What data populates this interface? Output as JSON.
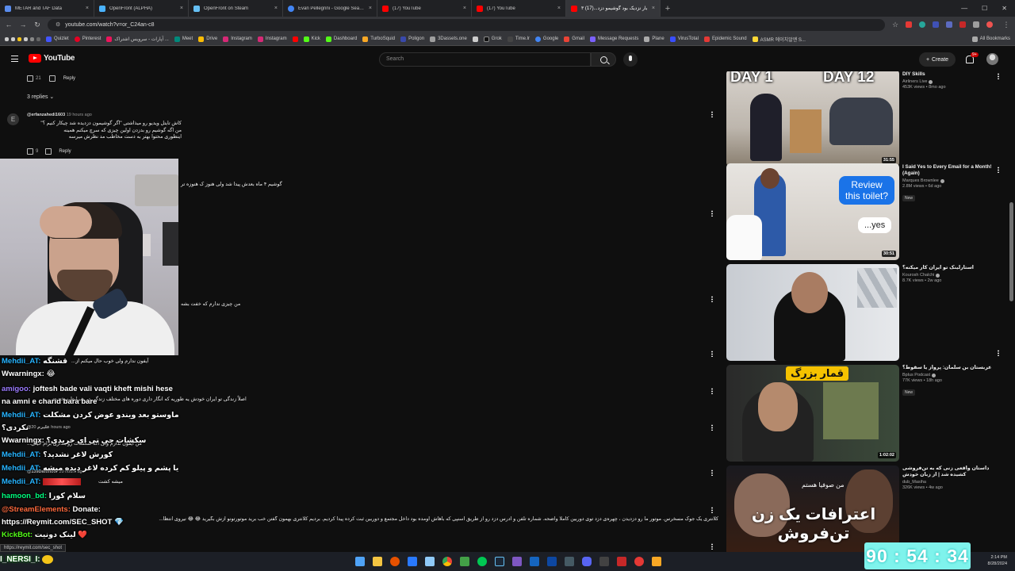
{
  "browser": {
    "tabs": [
      {
        "title": "METAR and TAF Data",
        "color": "#5a8dee"
      },
      {
        "title": "OpenFront (ALPHA)",
        "color": "#4ab3ff"
      },
      {
        "title": "OpenFront on Steam",
        "color": "#1b2838"
      },
      {
        "title": "Evan Pellegrini - Google Search",
        "color": "#4285f4"
      },
      {
        "title": "(17) YouTube",
        "color": "#ff0000"
      },
      {
        "title": "(17) YouTube",
        "color": "#ff0000"
      },
      {
        "title": "۳ بار نزدیک بود گوشیمو دزد...(17)",
        "color": "#ff0000"
      }
    ],
    "url": "youtube.com/watch?v=or_C24an-c8",
    "bookmarks": [
      "Quizlet",
      "Pinterest",
      "آپارات - سرویس اشتراک ...",
      "Meet",
      "Drive",
      "Instagram",
      "Instagram",
      "",
      "Kick",
      "Dashboard",
      "TurboSquid",
      "Poligon",
      "3Dassets.one",
      "",
      "Grok",
      "Time.lr",
      "Google",
      "Gmail",
      "Message Requests",
      "Plane",
      "VirusTotal",
      "Epidemic Sound",
      "ASMR 에이치알엔 S..."
    ],
    "all_bookmarks": "All Bookmarks",
    "status_url": "https://reymit.com/sec_shot"
  },
  "youtube": {
    "logo": "YouTube",
    "search_placeholder": "Search",
    "create": "Create",
    "notifications": "9+"
  },
  "comments": {
    "top_likes": "21",
    "reply": "Reply",
    "replies_toggle": "3 replies",
    "comment1": {
      "avatar": "E",
      "user": "@erfanzahedi1603",
      "time": "19 hours ago",
      "line1": "کاش تایتل ویدیو رو میذاشتی \"اگر گوشیمون دزدیده شد چیکار کنیم ؟\"",
      "line2": "من اگه گوشیم رو بدزدن اولین چیزی که سرچ میکنم همینه",
      "line3": "اینطوری محتوا بهتر به دست مخاطب مد نظرش میرسه",
      "likes": "9"
    },
    "rtl_a": "گوشیم ۴ ماه بعدش پیدا شد ولی هنوز ک هنوزه تر",
    "rtl_b": "من چیزی ندارم که خفت بشه",
    "rtl_c": "آیفون ندارم ولی خوب حال میکنم از...",
    "rtl_d": "اصلاً زندگی تو ایران خودش یه طوریه که انگار داری دوره های مختلف زندگی در شرایط سخت م...",
    "rtl_e": "من ایفون ندارم ولی اگه سکشات رو بندازی برام خیلی...",
    "rtl_f": "میشه کشت",
    "long_comment": "کلانتری یک جوک مسخرس. موتور ما رو دزدیدن ، چهره‌ی دزد توی دوربین کاملا واضحه. شماره تلفن و آدرس دزد رو از طریق اسنپی که باهاش اومده بود داخل مجتمع و دوربین ثبت کرده پیدا کردیم. بردیم کلانتری بهمون گفتن خب برید موتورتونو ازش بگیرید 😂 😂 نیروی انتظا...",
    "user2": "@علیرم",
    "time2": "20 hours ago",
    "user3": "@139Daftmoor",
    "time3": "20 hours ago"
  },
  "chat": [
    {
      "name": "Mehdii_AT:",
      "msg": "قشنگه",
      "color": "#27b4ff"
    },
    {
      "name": "Wwarningx:",
      "msg": "😂",
      "color": "#ffffff"
    },
    {
      "name": "amigoo:",
      "msg": "joftesh bade vali vaqti kheft mishi hese",
      "color": "#ffffff"
    },
    {
      "name": "",
      "msg": "na amni e charid bara bare",
      "color": "#ffffff"
    },
    {
      "name": "Mehdii_AT:",
      "msg": "ماوستو بعد ویندو عوض کردن مشکلت",
      "color": "#27b4ff"
    },
    {
      "name": "",
      "msg": "نکردی؟",
      "color": "#ffffff"
    },
    {
      "name": "Wwarningx:",
      "msg": "سکشات جی تی ای خریدی؟",
      "color": "#ffffff"
    },
    {
      "name": "Mehdii_AT:",
      "msg": "کورش لاغر نشدید؟",
      "color": "#27b4ff"
    },
    {
      "name": "Mehdii_AT:",
      "msg": "یا پشم و پیلو کم کرده لاغر دیده میشه",
      "color": "#27b4ff"
    },
    {
      "name": "Mehdii_AT:",
      "msg": "",
      "color": "#27b4ff"
    },
    {
      "name": "hamoon_bd:",
      "msg": "سلام کورا",
      "color": "#00ff7f"
    },
    {
      "name": "@StreamElements:",
      "msg": "Donate:",
      "color": "#ff6a3d"
    },
    {
      "name": "",
      "msg": "https://Reymit.com/SEC_SHOT 💎",
      "color": "#ffffff"
    },
    {
      "name": "KickBot:",
      "msg": "لینک دونیت ❤️",
      "color": "#53fc18"
    }
  ],
  "kick_user": "I_NERSI_I:",
  "recommendations": [
    {
      "title": "DIY Skills",
      "channel": "Airliners Live",
      "stats": "453K views • 8mo ago",
      "duration": "31:55",
      "new": "",
      "thumb_a": "DAY 1",
      "thumb_b": "DAY 12"
    },
    {
      "title": "I Said Yes to Every Email for a Month! (Again)",
      "channel": "Marques Brownlee",
      "stats": "2.8M views • 6d ago",
      "duration": "30:51",
      "new": "New",
      "thumb_a": "Review this toilet?",
      "thumb_b": "...yes"
    },
    {
      "title": "استارلینک تو ایران کار میکنه؟",
      "channel": "Kourosh Chalchi",
      "stats": "8.7K views • 2w ago",
      "duration": "",
      "new": "",
      "thumb_a": "",
      "thumb_b": ""
    },
    {
      "title": "عربستان بن سلمان: پرواز یا سقوط؟",
      "channel": "Bplus Podcast",
      "stats": "77K views • 18h ago",
      "duration": "1:02:02",
      "new": "New",
      "thumb_a": "قمار بزرگ",
      "thumb_b": ""
    },
    {
      "title": "داستان واقعی زنی که به تن‌فروشی کشیده شد | از زبان خودش",
      "channel": "dub_Masiha",
      "stats": "326K views • 4w ago",
      "duration": "",
      "new": "",
      "thumb_a": "من صوفیا هستم",
      "thumb_b": "اعترافات یک زن تن‌فروش"
    }
  ],
  "timer": "90 : 54 : 34",
  "clock": {
    "time": "2:14 PM",
    "date": "8/28/2024"
  }
}
